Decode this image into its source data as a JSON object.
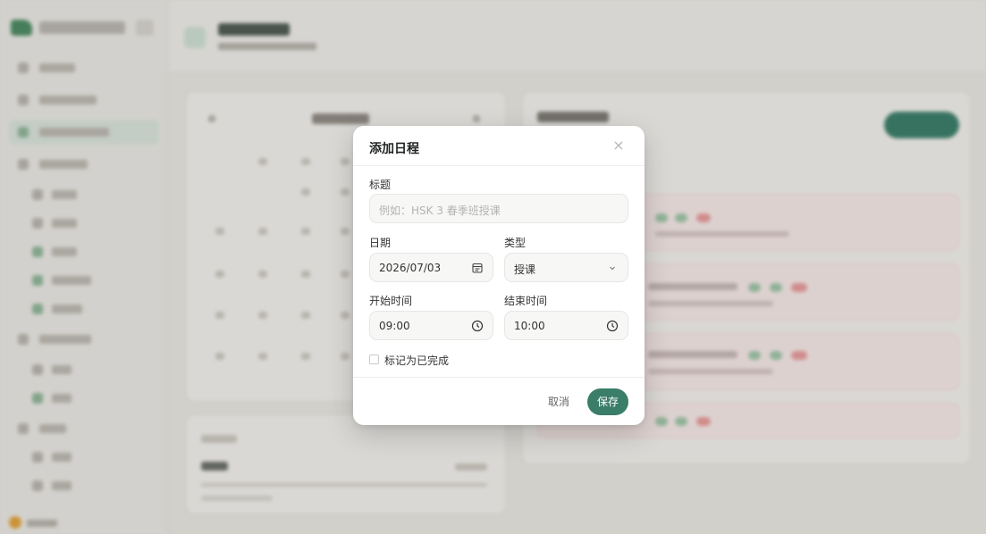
{
  "dialog": {
    "title": "添加日程",
    "close_glyph": "×",
    "title_field": {
      "label": "标题",
      "value": "",
      "placeholder": "例如：HSK 3 春季班授课"
    },
    "date_field": {
      "label": "日期",
      "value": "2026/07/03",
      "icon": "calendar-icon"
    },
    "type_field": {
      "label": "类型",
      "selected": "授课",
      "icon": "chevron-down-icon"
    },
    "start_time_field": {
      "label": "开始时间",
      "value": "09:00",
      "icon": "clock-icon"
    },
    "end_time_field": {
      "label": "结束时间",
      "value": "10:00",
      "icon": "clock-icon"
    },
    "completed_checkbox": {
      "label": "标记为已完成",
      "checked": false
    },
    "cancel_label": "取消",
    "save_label": "保存"
  },
  "colors": {
    "primary": "#3a7d69",
    "overlay": "rgba(40,40,35,0.12)",
    "dialog_bg": "#ffffff",
    "field_bg": "#f7f7f6",
    "status_red": "#e79a9a",
    "status_green": "#8fc09d"
  }
}
